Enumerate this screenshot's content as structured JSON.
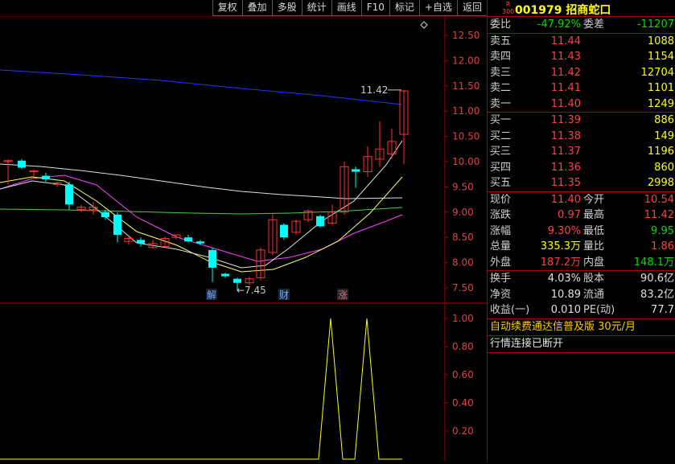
{
  "toolbar": [
    "复权",
    "叠加",
    "多股",
    "统计",
    "画线",
    "F10",
    "标记",
    "+自选",
    "返回"
  ],
  "stock": {
    "badge_top": "R",
    "badge_bottom": "300",
    "code_name": "001979 招商蛇口"
  },
  "chart": {
    "y_ticks": [
      "12.50",
      "12.00",
      "11.50",
      "11.00",
      "10.50",
      "10.00",
      "9.50",
      "9.00",
      "8.50",
      "8.00",
      "7.50"
    ],
    "high_label": "11.42",
    "low_label": "7.45",
    "events": [
      {
        "text": "解",
        "color": "#6ab0ff"
      },
      {
        "text": "财",
        "color": "#6ab0ff"
      },
      {
        "text": "涨",
        "color": "#ff6060"
      }
    ],
    "indicator_ticks": [
      "1.00",
      "0.80",
      "0.60",
      "0.40",
      "0.20"
    ],
    "colors": {
      "up": "#ff3030",
      "down": "#00ffff",
      "ma_white": "#e0e0e0",
      "ma_yellow": "#ffff60",
      "ma_magenta": "#ff40ff",
      "ma_green": "#40d040",
      "ma_blue": "#3030ff",
      "indicator": "#ffff00"
    }
  },
  "quote": {
    "weibi": {
      "label": "委比",
      "value": "-47.92%",
      "label2": "委差",
      "value2": "-11207"
    },
    "sells": [
      {
        "label": "卖五",
        "price": "11.44",
        "vol": "1088"
      },
      {
        "label": "卖四",
        "price": "11.43",
        "vol": "1154"
      },
      {
        "label": "卖三",
        "price": "11.42",
        "vol": "12704"
      },
      {
        "label": "卖二",
        "price": "11.41",
        "vol": "1101"
      },
      {
        "label": "卖一",
        "price": "11.40",
        "vol": "1249"
      }
    ],
    "buys": [
      {
        "label": "买一",
        "price": "11.39",
        "vol": "886"
      },
      {
        "label": "买二",
        "price": "11.38",
        "vol": "149"
      },
      {
        "label": "买三",
        "price": "11.37",
        "vol": "1196"
      },
      {
        "label": "买四",
        "price": "11.36",
        "vol": "860"
      },
      {
        "label": "买五",
        "price": "11.35",
        "vol": "2998"
      }
    ],
    "stats1": [
      {
        "l1": "现价",
        "v1": "11.40",
        "c1": "red",
        "l2": "今开",
        "v2": "10.54",
        "c2": "red"
      },
      {
        "l1": "涨跌",
        "v1": "0.97",
        "c1": "red",
        "l2": "最高",
        "v2": "11.42",
        "c2": "red"
      },
      {
        "l1": "涨幅",
        "v1": "9.30%",
        "c1": "red",
        "l2": "最低",
        "v2": "9.95",
        "c2": "green"
      },
      {
        "l1": "总量",
        "v1": "335.3万",
        "c1": "yellow",
        "l2": "量比",
        "v2": "1.86",
        "c2": "red"
      },
      {
        "l1": "外盘",
        "v1": "187.2万",
        "c1": "red",
        "l2": "内盘",
        "v2": "148.1万",
        "c2": "green"
      }
    ],
    "stats2": [
      {
        "l1": "换手",
        "v1": "4.03%",
        "l2": "股本",
        "v2": "90.6亿"
      },
      {
        "l1": "净资",
        "v1": "10.89",
        "l2": "流通",
        "v2": "83.2亿"
      },
      {
        "l1": "收益(一)",
        "v1": "0.010",
        "l2": "PE(动)",
        "v2": "77.7"
      }
    ],
    "promo": "自动续费通达信普及版  30元/月",
    "status": "行情连接已断开"
  }
}
